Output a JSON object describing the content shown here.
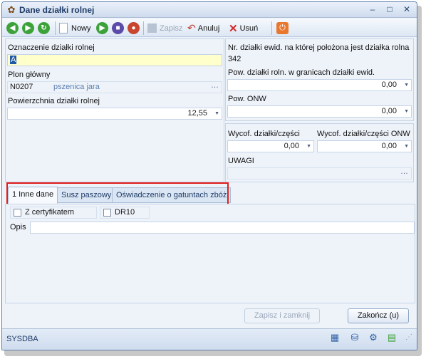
{
  "window": {
    "title": "Dane działki rolnej"
  },
  "toolbar": {
    "new_label": "Nowy",
    "save_label": "Zapisz",
    "cancel_label": "Anuluj",
    "delete_label": "Usuń"
  },
  "left": {
    "designation_label": "Oznaczenie działki rolnej",
    "designation_value": "A",
    "main_crop_label": "Plon główny",
    "main_crop_code": "N0207",
    "main_crop_name": "pszenica jara",
    "area_label": "Powierzchnia działki rolnej",
    "area_value": "12,55"
  },
  "right": {
    "parcel_no_label": "Nr. działki ewid. na której położona jest działka rolna",
    "parcel_no_value": "342",
    "area_in_parcel_label": "Pow. działki roln. w granicach działki ewid.",
    "area_in_parcel_value": "0,00",
    "onw_label": "Pow. ONW",
    "onw_value": "0,00",
    "withdraw_label": "Wycof. działki/części",
    "withdraw_value": "0,00",
    "withdraw_onw_label": "Wycof. działki/części ONW",
    "withdraw_onw_value": "0,00",
    "notes_label": "UWAGI"
  },
  "tabs": [
    {
      "label": "1 Inne dane"
    },
    {
      "label": "Susz paszowy"
    },
    {
      "label": "Oświadczenie o gatuntach zbóż"
    }
  ],
  "tab_content": {
    "cert_label": "Z certyfikatem",
    "dr10_label": "DR10",
    "desc_label": "Opis"
  },
  "footer": {
    "save_close_label": "Zapisz i zamknij",
    "finish_label": "Zakończ (u)",
    "user": "SYSDBA"
  },
  "colors": {
    "highlight": "#e11d1d",
    "accent": "#1f3b66"
  }
}
